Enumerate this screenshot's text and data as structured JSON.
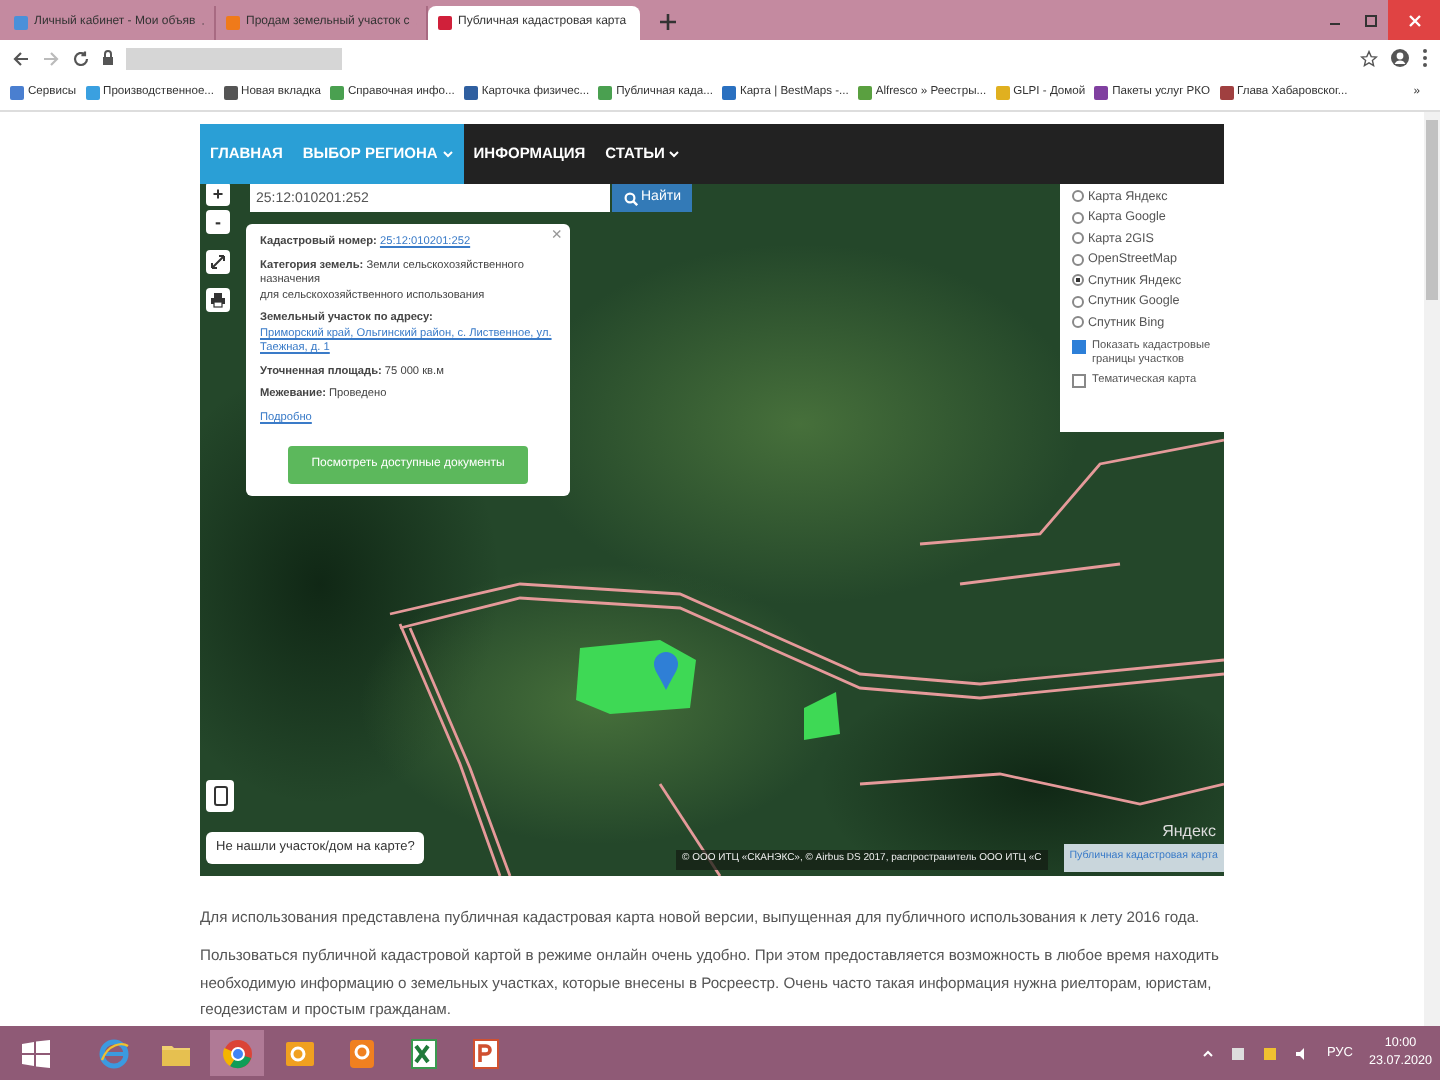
{
  "browser": {
    "tabs": [
      {
        "title": "Личный кабинет - Мои объяв",
        "selected": false,
        "color": "#4a90d9"
      },
      {
        "title": "Продам земельный участок с",
        "selected": false,
        "color": "#f07a1a"
      },
      {
        "title": "Публичная кадастровая карта",
        "selected": true,
        "color": "#d0203a"
      }
    ],
    "bookmarks": [
      {
        "label": "Сервисы",
        "color": "#4a7fd0"
      },
      {
        "label": "Производственное...",
        "color": "#3aa0e0"
      },
      {
        "label": "Новая вкладка",
        "color": "#555555"
      },
      {
        "label": "Справочная инфо...",
        "color": "#4aa050"
      },
      {
        "label": "Карточка физичес...",
        "color": "#2f5fa0"
      },
      {
        "label": "Публичная када...",
        "color": "#4aa050"
      },
      {
        "label": "Карта | BestMaps -...",
        "color": "#2a70c0"
      },
      {
        "label": "Alfresco » Реестры...",
        "color": "#5aa040"
      },
      {
        "label": "GLPI - Домой",
        "color": "#e0b020"
      },
      {
        "label": "Пакеты услуг РКО",
        "color": "#8040a0"
      },
      {
        "label": "Глава Хабаровског...",
        "color": "#a04040"
      },
      {
        "label": "»"
      }
    ]
  },
  "site_nav": {
    "items": [
      {
        "label": "ГЛАВНАЯ",
        "highlighted": true,
        "dropdown": false
      },
      {
        "label": "ВЫБОР РЕГИОНА",
        "highlighted": true,
        "dropdown": true
      },
      {
        "label": "ИНФОРМАЦИЯ",
        "highlighted": false,
        "dropdown": false
      },
      {
        "label": "СТАТЬИ",
        "highlighted": false,
        "dropdown": true
      }
    ]
  },
  "map": {
    "zoom_in": "+",
    "zoom_out": "-",
    "search": {
      "value": "25:12:010201:252",
      "button": "Найти"
    },
    "popup": {
      "close": "×",
      "fields": [
        {
          "label": "Кадастровый номер:",
          "value": "25:12:010201:252",
          "kind": "link"
        },
        {
          "label": "Категория земель:",
          "value": "Земли сельскохозяйственного назначения",
          "note": "для сельскохозяйственного использования",
          "kind": "text"
        },
        {
          "label": "Земельный участок по адресу:",
          "value": "Приморский край, Ольгинский район, с. Лиственное, ул. Таежная, д. 1",
          "kind": "link"
        },
        {
          "label": "Уточненная площадь:",
          "value": "75 000 кв.м",
          "kind": "text"
        },
        {
          "label": "Межевание:",
          "value": "Проведено",
          "kind": "text"
        }
      ],
      "more_link": "Подробно",
      "button": "Посмотреть доступные документы"
    },
    "layers": [
      {
        "label": "Карта Яндекс",
        "selected": false
      },
      {
        "label": "Карта Google",
        "selected": false
      },
      {
        "label": "Карта 2GIS",
        "selected": false
      },
      {
        "label": "OpenStreetMap",
        "selected": false
      },
      {
        "label": "Спутник Яндекс",
        "selected": true
      },
      {
        "label": "Спутник Google",
        "selected": false
      },
      {
        "label": "Спутник Bing",
        "selected": false
      }
    ],
    "overlays": [
      {
        "label": "Показать кадастровые границы участков",
        "checked": true
      },
      {
        "label": "Тематическая карта",
        "checked": false
      }
    ],
    "not_found_button": "Не нашли участок/дом на карте?",
    "attribution": "© ООО ИТЦ «СКАНЭКС», © Airbus DS 2017, распространитель ООО ИТЦ «С",
    "cadastre_link": "Публичная кадастровая карта",
    "provider_logo": "Яндекс"
  },
  "paragraphs": [
    "Для использования представлена публичная кадастровая карта новой версии, выпущенная для публичного использования к лету 2016 года.",
    "Пользоваться публичной кадастровой картой в режиме онлайн очень удобно. При этом предоставляется возможность в любое время находить необходимую информацию о земельных участках, которые внесены в Росреестр. Очень часто такая информация нужна риелторам, юристам, геодезистам и простым гражданам."
  ],
  "taskbar": {
    "language": "РУС",
    "time": "10:00",
    "date": "23.07.2020"
  }
}
